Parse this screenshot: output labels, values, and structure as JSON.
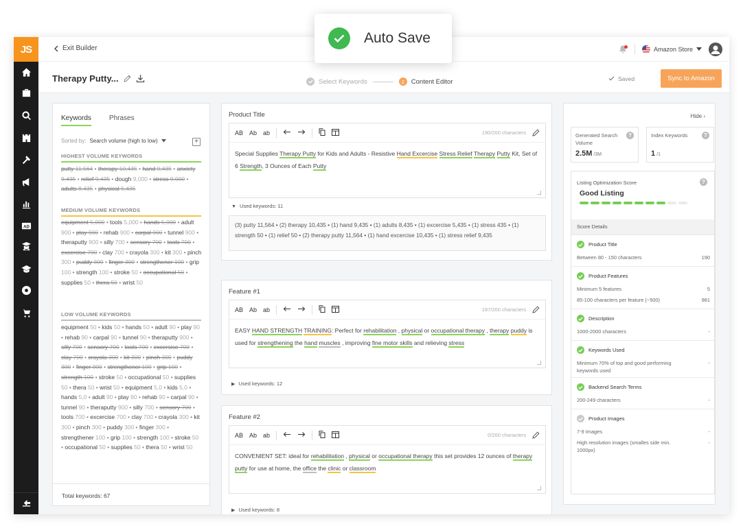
{
  "toast": {
    "label": "Auto Save"
  },
  "app": {
    "logo": "JS"
  },
  "sidebar": {
    "icons": [
      "home-icon",
      "briefcase-icon",
      "search-icon",
      "castle-icon",
      "hammer-icon",
      "megaphone-icon",
      "bar-chart-icon",
      "ad-icon",
      "student-icon",
      "graduation-cap-icon",
      "chrome-icon",
      "cart-icon"
    ],
    "bottom_icon": "collapse-sidebar-icon"
  },
  "topbar": {
    "exit_label": "Exit Builder",
    "store_label": "Amazon Store"
  },
  "builder": {
    "product_title": "Therapy Putty...",
    "steps": [
      {
        "num": "",
        "label": "Select Keywords"
      },
      {
        "num": "2",
        "label": "Content Editor"
      }
    ],
    "saved_label": "Saved",
    "sync_label": "Sync to Amazon"
  },
  "keywords_panel": {
    "tabs": [
      "Keywords",
      "Phrases"
    ],
    "sorted_by_label": "Sorted by:",
    "sorted_by_value": "Search volume (high to low)",
    "sections": [
      {
        "title": "HIGHEST VOLUME KEYWORDS",
        "color": "#8bd35b",
        "items": [
          [
            "putty",
            "11,564",
            1
          ],
          [
            "therapy",
            "10,435",
            1
          ],
          [
            "hand",
            "9,435",
            1
          ],
          [
            "anxiety",
            "9,435",
            1
          ],
          [
            "relief",
            "9,435",
            1
          ],
          [
            "dough",
            "9,000",
            0
          ],
          [
            "stress",
            "9,000",
            1
          ],
          [
            "adults",
            "8,435",
            1
          ],
          [
            "physical",
            "5,435",
            1
          ]
        ]
      },
      {
        "title": "MEDIUM VOLUME KEYWORDS",
        "color": "#f5c342",
        "items": [
          [
            "equipment",
            "5,000",
            1
          ],
          [
            "tools",
            "5,000",
            0
          ],
          [
            "hands",
            "5,000",
            1
          ],
          [
            "adult",
            "900",
            0
          ],
          [
            "play",
            "900",
            1
          ],
          [
            "rehab",
            "900",
            0
          ],
          [
            "carpal",
            "900",
            1
          ],
          [
            "tunnel",
            "900",
            0
          ],
          [
            "theraputty",
            "900",
            0
          ],
          [
            "silly",
            "700",
            0
          ],
          [
            "sensory",
            "700",
            1
          ],
          [
            "tools",
            "700",
            1
          ],
          [
            "excercise",
            "700",
            1
          ],
          [
            "clay",
            "700",
            0
          ],
          [
            "crayola",
            "300",
            0
          ],
          [
            "kit",
            "300",
            0
          ],
          [
            "pinch",
            "300",
            0
          ],
          [
            "puddy",
            "300",
            1
          ],
          [
            "finger",
            "300",
            1
          ],
          [
            "strengthener",
            "100",
            1
          ],
          [
            "grip",
            "100",
            0
          ],
          [
            "strength",
            "100",
            0
          ],
          [
            "stroke",
            "50",
            0
          ],
          [
            "occupational",
            "50",
            1
          ],
          [
            "supplies",
            "50",
            0
          ],
          [
            "thera",
            "50",
            1
          ],
          [
            "wrist",
            "50",
            0
          ]
        ]
      },
      {
        "title": "LOW VOLUME KEYWORDS",
        "color": "#bdbdbd",
        "items": [
          [
            "equipment",
            "50",
            0
          ],
          [
            "kids",
            "50",
            0
          ],
          [
            "hands",
            "50",
            0
          ],
          [
            "adult",
            "90",
            0
          ],
          [
            "play",
            "90",
            0
          ],
          [
            "rehab",
            "90",
            0
          ],
          [
            "carpal",
            "90",
            0
          ],
          [
            "tunnel",
            "90",
            0
          ],
          [
            "theraputty",
            "900",
            0
          ],
          [
            "silly",
            "700",
            1
          ],
          [
            "sensory",
            "700",
            1
          ],
          [
            "tools",
            "700",
            1
          ],
          [
            "excersise",
            "700",
            1
          ],
          [
            "clay",
            "700",
            1
          ],
          [
            "crayola",
            "300",
            1
          ],
          [
            "kit",
            "300",
            1
          ],
          [
            "pinch",
            "300",
            1
          ],
          [
            "puddy",
            "300",
            1
          ],
          [
            "finger",
            "300",
            1
          ],
          [
            "strengthener",
            "100",
            1
          ],
          [
            "grip",
            "100",
            1
          ],
          [
            "strength",
            "100",
            1
          ],
          [
            "stroke",
            "50",
            0
          ],
          [
            "occupational",
            "50",
            0
          ],
          [
            "supplies",
            "50",
            0
          ],
          [
            "thera",
            "50",
            0
          ],
          [
            "wrist",
            "50",
            0
          ],
          [
            "equipment",
            "5,0",
            0
          ],
          [
            "kids",
            "5,0",
            0
          ],
          [
            "hands",
            "5,0",
            0
          ],
          [
            "adult",
            "90",
            0
          ],
          [
            "play",
            "90",
            0
          ],
          [
            "rehab",
            "90",
            0
          ],
          [
            "carpal",
            "90",
            0
          ],
          [
            "tunnel",
            "90",
            0
          ],
          [
            "theraputty",
            "900",
            0
          ],
          [
            "silly",
            "700",
            0
          ],
          [
            "sensory",
            "700",
            1
          ],
          [
            "tools",
            "700",
            0
          ],
          [
            "excercise",
            "700",
            0
          ],
          [
            "clay",
            "700",
            0
          ],
          [
            "crayola",
            "300",
            0
          ],
          [
            "kit",
            "300",
            0
          ],
          [
            "pinch",
            "300",
            0
          ],
          [
            "puddy",
            "300",
            0
          ],
          [
            "finger",
            "300",
            0
          ],
          [
            "strengthener",
            "100",
            0
          ],
          [
            "grip",
            "100",
            0
          ],
          [
            "strength",
            "100",
            0
          ],
          [
            "stroke",
            "50",
            0
          ],
          [
            "occupational",
            "50",
            0
          ],
          [
            "supplies",
            "50",
            0
          ],
          [
            "thera",
            "50",
            0
          ],
          [
            "wrist",
            "50",
            0
          ]
        ]
      }
    ],
    "footer": "Total keywords: 67"
  },
  "toolbar": {
    "b1": "AB",
    "b2": "Ab",
    "b3": "ab"
  },
  "editors": [
    {
      "label": "Product Title",
      "chars": "190/200 characters",
      "text": [
        [
          "Special Supplies ",
          ""
        ],
        [
          "Therapy Putty",
          "u"
        ],
        [
          " for Kids and Adults - Resistive ",
          ""
        ],
        [
          "Hand Excercise",
          "uy"
        ],
        [
          " ",
          ""
        ],
        [
          "Stress Relief",
          "u"
        ],
        [
          " ",
          ""
        ],
        [
          "Therapy",
          "u"
        ],
        [
          " ",
          ""
        ],
        [
          "Putty",
          "u"
        ],
        [
          " Kit, Set of 6 ",
          ""
        ],
        [
          "Strength",
          "u"
        ],
        [
          ", 3 Ounces of Each ",
          ""
        ],
        [
          "Putty",
          "u"
        ]
      ],
      "used_label": "Used keywords: 11",
      "used_text": "(3) putty 11,564 • (2) therapy 10,435 • (1) hand 9,435 • (1) adults 8,435 • (1) excercise 5,435 • (1) stress 435 • (1) strength 50 • (1) relief 50 • (2) therapy putty 11,564 • (1) hand excercise 10,435 • (1) stress relief 9,435"
    },
    {
      "label": "Feature #1",
      "chars": "187/200 characters",
      "text": [
        [
          "EASY ",
          ""
        ],
        [
          "HAND STRENGTH",
          "u"
        ],
        [
          " ",
          ""
        ],
        [
          "TRAINING",
          "uy"
        ],
        [
          ": Perfect for ",
          ""
        ],
        [
          "rehabilitation",
          "u"
        ],
        [
          " , ",
          ""
        ],
        [
          "physical",
          "u"
        ],
        [
          " or ",
          ""
        ],
        [
          "occupational therapy",
          "u"
        ],
        [
          " , ",
          ""
        ],
        [
          "therapy",
          "u"
        ],
        [
          " ",
          ""
        ],
        [
          "puddy",
          "uy"
        ],
        [
          " is used for ",
          ""
        ],
        [
          "strengthening",
          "u"
        ],
        [
          " the ",
          ""
        ],
        [
          "hand",
          "u"
        ],
        [
          " ",
          ""
        ],
        [
          "muscles",
          "ug"
        ],
        [
          " , improving ",
          ""
        ],
        [
          "fine motor skills",
          "u"
        ],
        [
          " and relieving ",
          ""
        ],
        [
          "stress",
          "u"
        ]
      ],
      "used_label": "Used keywords: 12",
      "used_text": ""
    },
    {
      "label": "Feature #2",
      "chars": "0/200 characters",
      "text": [
        [
          "CONVENIENT SET: ideal for ",
          ""
        ],
        [
          "rehabilitation",
          "u"
        ],
        [
          " , ",
          ""
        ],
        [
          "physical",
          "u"
        ],
        [
          " or ",
          ""
        ],
        [
          "occupational therapy",
          "u"
        ],
        [
          " this set provides 12 ounces of ",
          ""
        ],
        [
          "therapy",
          "u"
        ],
        [
          " ",
          ""
        ],
        [
          "putty",
          "u"
        ],
        [
          " for use at home, the ",
          ""
        ],
        [
          "office",
          "ug"
        ],
        [
          " the ",
          ""
        ],
        [
          "clinic",
          "uy"
        ],
        [
          " or ",
          ""
        ],
        [
          "classroom",
          "uy"
        ]
      ],
      "used_label": "Used keywords: 8",
      "used_text": ""
    }
  ],
  "score_panel": {
    "hide_label": "Hide",
    "generated_label": "Generated Search Volume",
    "generated_value": "2.5M",
    "generated_unit": "/3M",
    "index_label": "Index Keywords",
    "index_value": "1",
    "index_unit": "/1",
    "opt_label": "Listing Optimization Score",
    "opt_value": "Good Listing",
    "opt_segments_filled": 8,
    "opt_segments_total": 10,
    "details_label": "Score Details",
    "criteria": [
      {
        "title": "Product Title",
        "ok": true,
        "rows": [
          [
            "Between 80 - 150 characters",
            "190"
          ]
        ]
      },
      {
        "title": "Product Features",
        "ok": true,
        "rows": [
          [
            "Minimum 5 features",
            "5"
          ],
          [
            "85-100 characters per feature (~500)",
            "981"
          ]
        ]
      },
      {
        "title": "Description",
        "ok": true,
        "rows": [
          [
            "1000-2000 characters",
            "-"
          ]
        ]
      },
      {
        "title": "Keywords Used",
        "ok": true,
        "rows": [
          [
            "Minimum 70% of top and good performing keywords used",
            "-"
          ]
        ]
      },
      {
        "title": "Backend Search Terms",
        "ok": true,
        "rows": [
          [
            "200-249 characters",
            "-"
          ]
        ]
      },
      {
        "title": "Product Images",
        "ok": false,
        "rows": [
          [
            "7-9 Images",
            "-"
          ],
          [
            "High resolution images (smalles side min. 1000px)",
            "-"
          ]
        ]
      }
    ]
  }
}
